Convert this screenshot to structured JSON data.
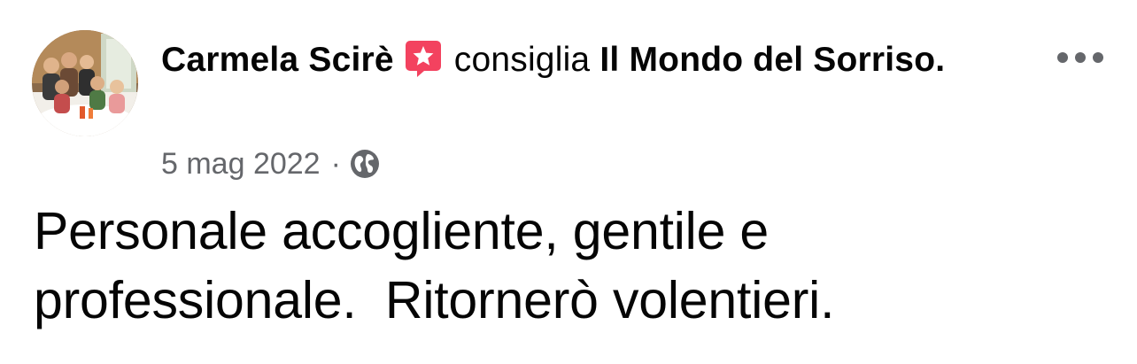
{
  "post": {
    "author": "Carmela Scirè",
    "verb": "consiglia",
    "page_name": "Il Mondo del Sorriso.",
    "date": "5 mag 2022",
    "separator": "·",
    "visibility_icon": "globe-icon",
    "badge_icon": "recommend-star-icon",
    "menu_icon": "more-options-icon",
    "text": "Personale accogliente, gentile e\nprofessionale.  Ritornerò volentieri."
  },
  "colors": {
    "badge": "#f3425f",
    "meta_text": "#65676b",
    "main_text": "#050505"
  }
}
